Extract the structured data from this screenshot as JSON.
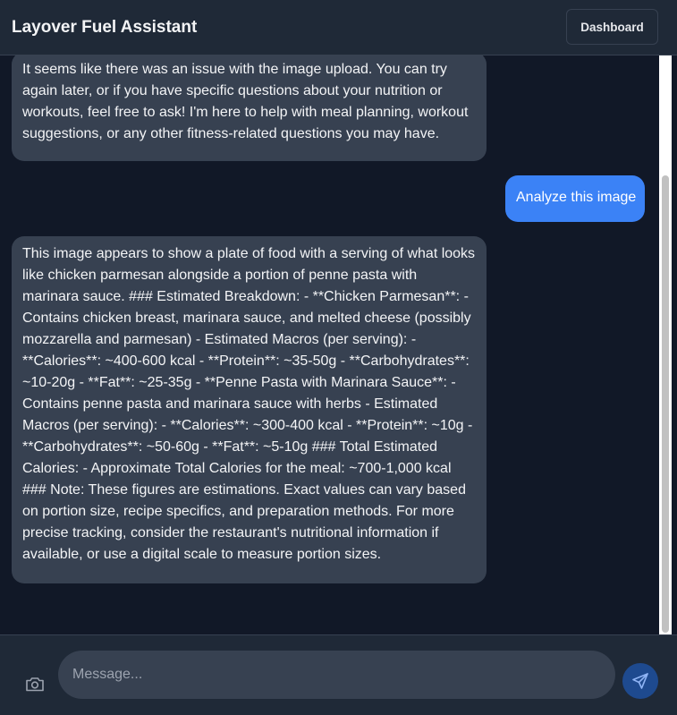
{
  "header": {
    "title": "Layover Fuel Assistant",
    "dashboard_label": "Dashboard"
  },
  "messages": [
    {
      "role": "assistant",
      "text": "It seems like there was an issue with the image upload. You can try again later, or if you have specific questions about your nutrition or workouts, feel free to ask! I'm here to help with meal planning, workout suggestions, or any other fitness-related questions you may have."
    },
    {
      "role": "user",
      "text": "Analyze this image"
    },
    {
      "role": "assistant",
      "text": "This image appears to show a plate of food with a serving of what looks like chicken parmesan alongside a portion of penne pasta with marinara sauce. ### Estimated Breakdown: - **Chicken Parmesan**: - Contains chicken breast, marinara sauce, and melted cheese (possibly mozzarella and parmesan) - Estimated Macros (per serving): - **Calories**: ~400-600 kcal - **Protein**: ~35-50g - **Carbohydrates**: ~10-20g - **Fat**: ~25-35g - **Penne Pasta with Marinara Sauce**: - Contains penne pasta and marinara sauce with herbs - Estimated Macros (per serving): - **Calories**: ~300-400 kcal - **Protein**: ~10g - **Carbohydrates**: ~50-60g - **Fat**: ~5-10g ### Total Estimated Calories: - Approximate Total Calories for the meal: ~700-1,000 kcal ### Note: These figures are estimations. Exact values can vary based on portion size, recipe specifics, and preparation methods. For more precise tracking, consider the restaurant's nutritional information if available, or use a digital scale to measure portion sizes."
    }
  ],
  "composer": {
    "placeholder": "Message...",
    "camera_icon": "camera-icon",
    "send_icon": "send-icon"
  },
  "colors": {
    "background": "#111827",
    "header": "#1f2937",
    "assistant_bubble": "#374151",
    "user_bubble": "#3b82f6",
    "send_button": "#1e4a8f"
  }
}
